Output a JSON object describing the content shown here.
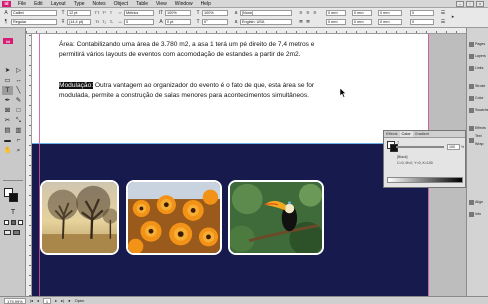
{
  "app": {
    "logo": "Id"
  },
  "menu": [
    "File",
    "Edit",
    "Layout",
    "Type",
    "Notes",
    "Object",
    "Table",
    "View",
    "Window",
    "Help"
  ],
  "control": {
    "font_family": "Calibri",
    "font_style": "Regular",
    "font_size": "12 pt",
    "leading": "(14,4 pt)",
    "kerning": "Metrics",
    "tracking": "0",
    "vscale": "100%",
    "hscale": "100%",
    "baseline": "0 pt",
    "skew": "0°",
    "char_style": "[None]",
    "language": "English: USA",
    "indent_1": "0 mm",
    "indent_2": "0 mm",
    "indent_3": "0 mm",
    "indent_4": "0 mm"
  },
  "document": {
    "paragraph_1": "Área: Contabilizando uma área de 3.780 m2, a asa 1 terá um pé direito de 7,4 metros e permitirá vários layouts de eventos com acomodação de estandes a partir de 2m2.",
    "paragraph_2_highlight": "Modulação:",
    "paragraph_2_rest": " Outra vantagem ao organizador do evento é o fato de que, esta área se for modulada, permite a construção de salas menores para acontecimentos simultâneos."
  },
  "images": [
    "trees-photo",
    "flowers-photo",
    "toucan-photo"
  ],
  "color_panel": {
    "tabs": [
      "Effects",
      "Color",
      "Gradient"
    ],
    "active_tab": "Color",
    "tint_label": "T",
    "tint_value": "100",
    "percent": "%",
    "swatch_name": "[Black]",
    "swatch_desc": "C=0, M=0, Y=0, K=100"
  },
  "dock_labels": [
    "Pages",
    "Layers",
    "Links",
    "Stroke",
    "Color",
    "Swatches",
    "Effects",
    "Text Wrap",
    "Align",
    "Info"
  ],
  "status": {
    "zoom": "175,99%",
    "page": "1",
    "preflight": "Open"
  },
  "colors": {
    "navy": "#161a4d",
    "magenta": "#d41e76"
  }
}
